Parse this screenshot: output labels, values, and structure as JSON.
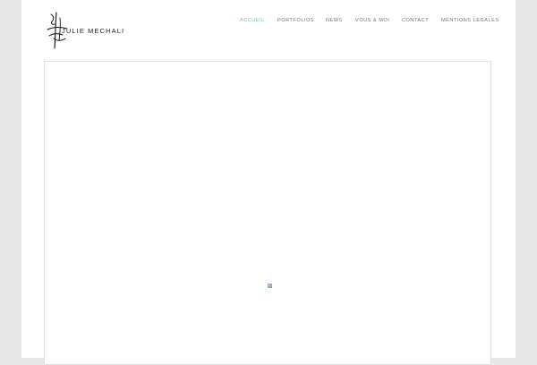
{
  "brand": {
    "logo_text": "JULIE MECHALI",
    "logo_icon": "signature-monogram-icon"
  },
  "nav": {
    "items": [
      {
        "label": "ACCUEIL",
        "active": true
      },
      {
        "label": "PORTFOLIOS",
        "active": false
      },
      {
        "label": "NEWS",
        "active": false
      },
      {
        "label": "VOUS & MOI",
        "active": false
      },
      {
        "label": "CONTACT",
        "active": false
      },
      {
        "label": "MENTIONS LEGALES",
        "active": false
      }
    ]
  },
  "content": {
    "image_icon": "broken-image-icon"
  },
  "colors": {
    "accent": "#79c4b4",
    "nav_text": "#777777",
    "page_background": "#e8e8e8",
    "panel_background": "#ffffff",
    "border": "#e1e1e1"
  }
}
